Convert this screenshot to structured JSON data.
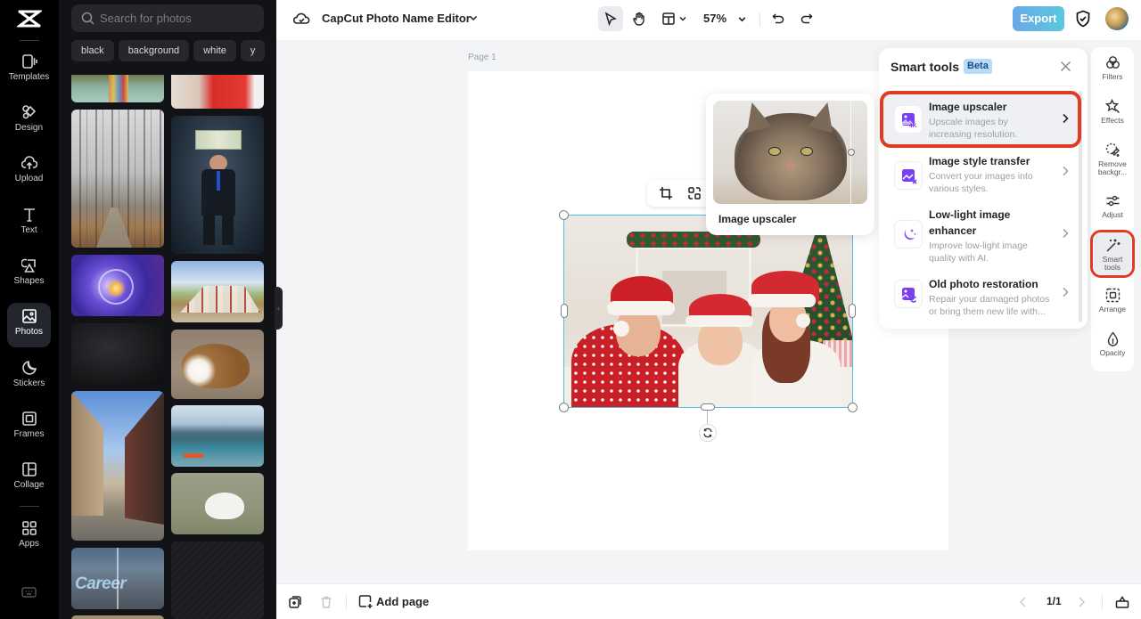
{
  "app": {
    "name": "CapCut"
  },
  "left_rail": {
    "items": [
      {
        "label": "Templates",
        "icon": "templates-icon"
      },
      {
        "label": "Design",
        "icon": "design-icon"
      },
      {
        "label": "Upload",
        "icon": "upload-icon"
      },
      {
        "label": "Text",
        "icon": "text-icon"
      },
      {
        "label": "Shapes",
        "icon": "shapes-icon"
      },
      {
        "label": "Photos",
        "icon": "photos-icon",
        "active": true
      },
      {
        "label": "Stickers",
        "icon": "stickers-icon"
      },
      {
        "label": "Frames",
        "icon": "frames-icon"
      },
      {
        "label": "Collage",
        "icon": "collage-icon"
      },
      {
        "label": "Apps",
        "icon": "apps-icon"
      }
    ]
  },
  "photos_panel": {
    "search_placeholder": "Search for photos",
    "search_value": "",
    "chips": [
      "black",
      "background",
      "white",
      "y"
    ],
    "thumbnails": [
      "river-bridge-flags",
      "red-jacket-street",
      "foggy-forest-path",
      "man-holding-dollar-bill",
      "candle-in-glass",
      "hillside-temples",
      "dark-grunge-texture",
      "guinea-pig",
      "european-street",
      "mountain-lake-boats",
      "white-puppy-on-grass",
      "career-road",
      "dark-pattern"
    ]
  },
  "topbar": {
    "doc_title": "CapCut Photo Name Editor",
    "zoom": "57%",
    "export_label": "Export"
  },
  "canvas": {
    "page_label": "Page 1",
    "selected_image": "family-christmas-photo"
  },
  "preview_popup": {
    "label": "Image upscaler"
  },
  "smart_tools": {
    "title": "Smart tools",
    "badge": "Beta",
    "tools": [
      {
        "name": "Image upscaler",
        "desc_line1": "Upscale images by",
        "desc_line2": "increasing resolution.",
        "highlighted": true
      },
      {
        "name": "Image style transfer",
        "desc_line1": "Convert your images into",
        "desc_line2": "various styles."
      },
      {
        "name_line1": "Low-light image",
        "name_line2": "enhancer",
        "desc_line1": "Improve low-light image",
        "desc_line2": "quality with AI."
      },
      {
        "name": "Old photo restoration",
        "desc_line1": "Repair your damaged photos",
        "desc_line2": "or bring them new life with..."
      }
    ]
  },
  "property_rail": {
    "items": [
      {
        "label": "Filters"
      },
      {
        "label": "Effects"
      },
      {
        "label_line1": "Remove",
        "label_line2": "backgr..."
      },
      {
        "label": "Adjust"
      },
      {
        "label_line1": "Smart",
        "label_line2": "tools",
        "active": true
      },
      {
        "label": "Arrange"
      },
      {
        "label": "Opacity"
      }
    ]
  },
  "bottombar": {
    "add_page_label": "Add page",
    "pager": "1/1"
  },
  "colors": {
    "accent_highlight": "#e23b24",
    "selection": "#4cc0e0",
    "tool_purple": "#7b3ff2",
    "export_gradient_start": "#6aa8e8",
    "export_gradient_end": "#5ac9dd"
  }
}
